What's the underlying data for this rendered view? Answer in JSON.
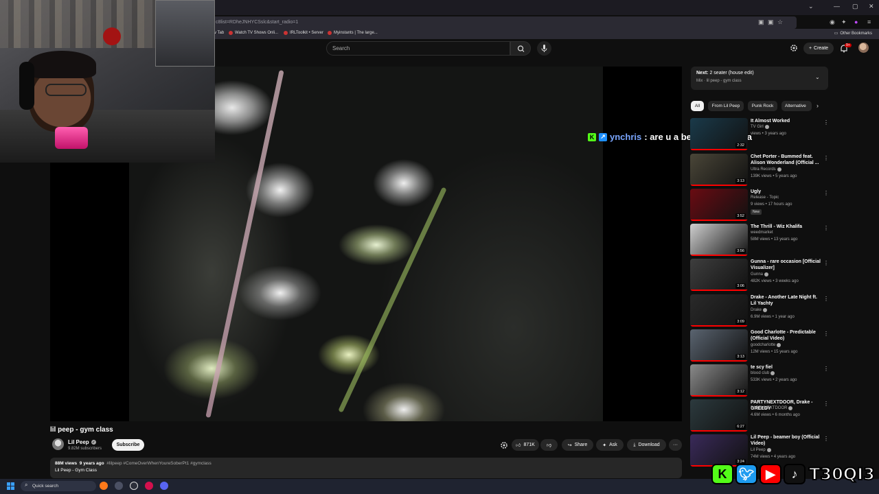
{
  "browser": {
    "url_fragment": "c8list=RDheJNHYCSslc&start_radio=1",
    "bookmarks": [
      {
        "label": "v Tab",
        "x": 0
      },
      {
        "label": "Watch TV Shows Onli..."
      },
      {
        "label": "IRLToolkit • Server"
      },
      {
        "label": "Myinstants | The large..."
      }
    ],
    "other_bookmarks": "Other Bookmarks"
  },
  "header": {
    "search_placeholder": "Search",
    "create_label": "Create",
    "notifications_count": "9+"
  },
  "chat": {
    "username": "ynchris",
    "message": ": are u a beamer boy teqa"
  },
  "video": {
    "title": "lil peep - gym class",
    "channel": "Lil Peep",
    "subscribers": "9.82M subscribers",
    "subscribe_label": "Subscribe",
    "likes": "871K",
    "share_label": "Share",
    "ask_label": "Ask",
    "download_label": "Download",
    "views": "88M views",
    "age": "9 years ago",
    "hashtags": "#lilpeep #ComeOverWhenYoureSoberPt1 #gymclass",
    "description": "Lil Peep - Gym Class"
  },
  "next": {
    "prefix": "Next:",
    "title": "2 seater (house edit)",
    "subtitle": "Mix · lil peep - gym class"
  },
  "chips": [
    "All",
    "From Lil Peep",
    "Punk Rock",
    "Alternative"
  ],
  "recommendations": [
    {
      "title": "It Almost Worked",
      "channel": "TV Girl",
      "verified": true,
      "meta": "views • 3 years ago",
      "duration": "2:32",
      "color": "#1a3a4a"
    },
    {
      "title": "Chet Porter - Bummed feat. Alison Wonderland (Official ...",
      "channel": "Ultra Records",
      "verified": true,
      "meta": "139K views • 5 years ago",
      "duration": "3:13",
      "color": "#4a4638"
    },
    {
      "title": "Ugly",
      "channel": "Release - Topic",
      "verified": false,
      "meta": "9 views • 17 hours ago",
      "duration": "3:52",
      "badge": "New",
      "color": "#6a0b12"
    },
    {
      "title": "The Thrill - Wiz Khalifa",
      "channel": "weedmarket",
      "verified": false,
      "meta": "58M views • 13 years ago",
      "duration": "3:56",
      "color": "#cfcfcf"
    },
    {
      "title": "Gunna - rare occasion [Official Visualizer]",
      "channel": "Gunna",
      "verified": true,
      "meta": "482K views • 3 weeks ago",
      "duration": "3:06",
      "color": "#3e3e3e"
    },
    {
      "title": "Drake - Another Late Night ft. Lil Yachty",
      "channel": "Drake",
      "verified": true,
      "meta": "6.9M views • 1 year ago",
      "duration": "3:09",
      "color": "#2a2a2a"
    },
    {
      "title": "Good Charlotte - Predictable (Official Video)",
      "channel": "goodcharlotte",
      "verified": true,
      "meta": "12M views • 15 years ago",
      "duration": "3:13",
      "color": "#5a6470"
    },
    {
      "title": "te scy fiel",
      "channel": "blood club",
      "verified": true,
      "meta": "533K views • 2 years ago",
      "duration": "3:12",
      "color": "#8a8a8a"
    },
    {
      "title": "PARTYNEXTDOOR, Drake - GREEDY",
      "channel": "PARTYNEXTDOOR",
      "verified": true,
      "meta": "4.6M views • 6 months ago",
      "duration": "6:27",
      "color": "#2c3a3e"
    },
    {
      "title": "Lil Peep - beamer boy (Official Video)",
      "channel": "Lil Peep",
      "verified": true,
      "meta": "74M views • 4 years ago",
      "duration": "3:24",
      "color": "#3a2a5a"
    }
  ],
  "taskbar": {
    "search_label": "Quick search"
  },
  "overlay": {
    "handle": "T30QI3"
  }
}
